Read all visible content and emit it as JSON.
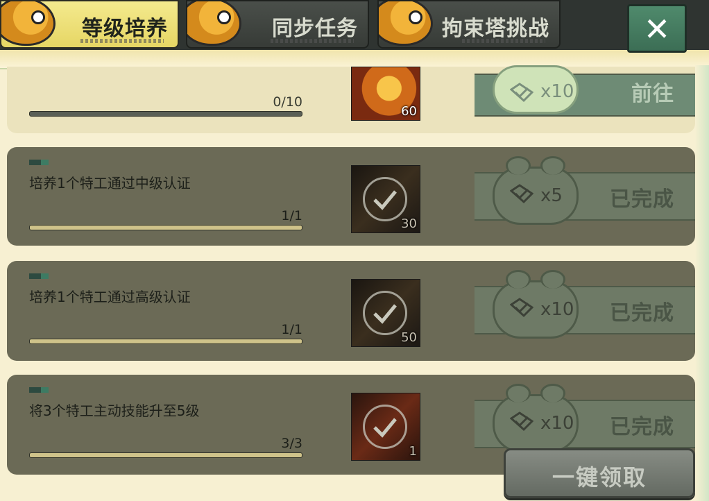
{
  "tabs": [
    {
      "label": "等级培养",
      "active": true
    },
    {
      "label": "同步任务",
      "active": false
    },
    {
      "label": "拘束塔挑战",
      "active": false
    }
  ],
  "close_label": "✕",
  "tasks": [
    {
      "title": "",
      "progress_text": "0/10",
      "progress": 0.0,
      "reward_qty": "60",
      "chip_qty": "x10",
      "action_label": "前往",
      "completed": false
    },
    {
      "title": "培养1个特工通过中级认证",
      "progress_text": "1/1",
      "progress": 1.0,
      "reward_qty": "30",
      "chip_qty": "x5",
      "action_label": "已完成",
      "completed": true
    },
    {
      "title": "培养1个特工通过高级认证",
      "progress_text": "1/1",
      "progress": 1.0,
      "reward_qty": "50",
      "chip_qty": "x10",
      "action_label": "已完成",
      "completed": true
    },
    {
      "title": "将3个特工主动技能升至5级",
      "progress_text": "3/3",
      "progress": 1.0,
      "reward_qty": "1",
      "chip_qty": "x10",
      "action_label": "已完成",
      "completed": true
    }
  ],
  "claim_all_label": "一键领取",
  "colors": {
    "active_tab": "#e6d664",
    "inactive_tab": "#3d413d",
    "close_button": "#3c6e55",
    "completed_row": "#6b6a56",
    "background": "#f7f0d2"
  }
}
